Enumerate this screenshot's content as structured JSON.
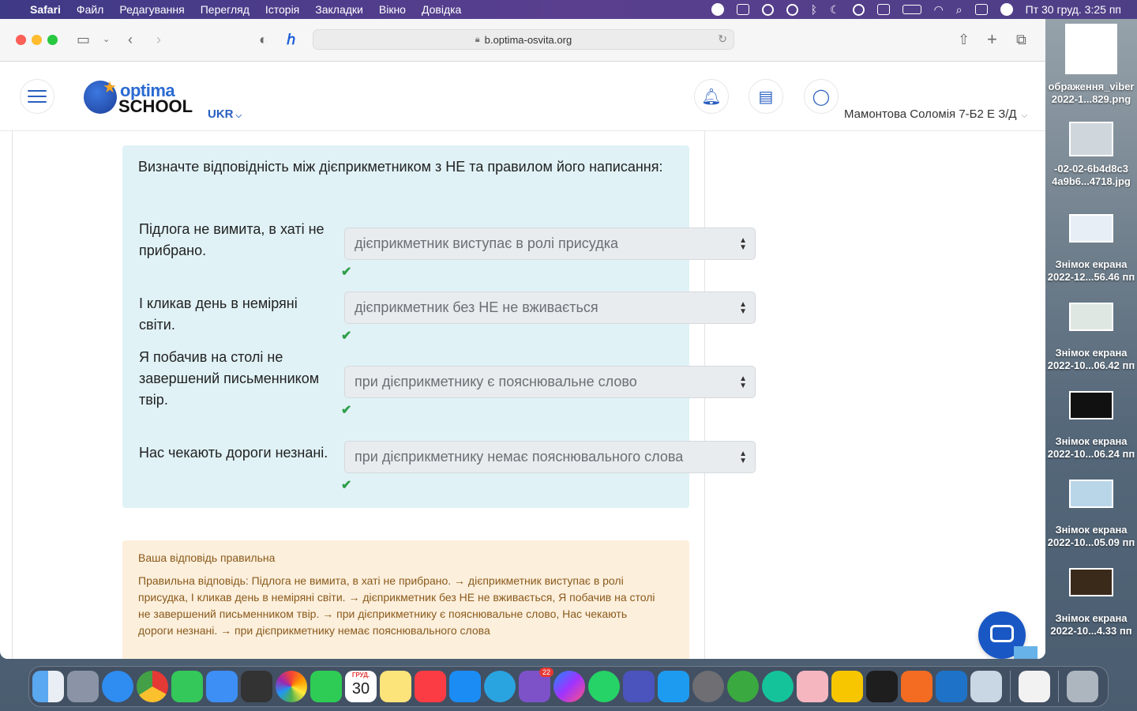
{
  "menubar": {
    "app": "Safari",
    "items": [
      "Файл",
      "Редагування",
      "Перегляд",
      "Історія",
      "Закладки",
      "Вікно",
      "Довідка"
    ],
    "clock": "Пт 30 груд.  3:25 пп"
  },
  "browser": {
    "url": "b.optima-osvita.org"
  },
  "header": {
    "logo_top": "optima",
    "logo_bottom": "SCHOOL",
    "language": "UKR",
    "user_name": "Мамонтова Соломія 7-Б2 Е З/Д"
  },
  "question": {
    "text": "Визначте відповідність між  дієприкметником з НЕ  та правилом його написання:",
    "rows": [
      {
        "label": "Підлога не вимита, в хаті не прибрано.",
        "answer": "дієприкметник виступає в ролі присудка"
      },
      {
        "label": "І кликав день в неміряні світи.",
        "answer": "дієприкметник без НЕ не вживається"
      },
      {
        "label": "Я побачив на столі не завершений письменником твір.",
        "answer": "при дієприкметнику є пояснювальне слово"
      },
      {
        "label": "Нас чекають дороги незнані.",
        "answer": "при дієприкметнику немає пояснювального слова"
      }
    ]
  },
  "feedback": {
    "title": "Ваша відповідь правильна",
    "body": "Правильна відповідь: Підлога не вимита, в хаті не прибрано. → дієприкметник виступає в ролі присудка, І кликав день в неміряні світи. → дієприкметник без НЕ не вживається, Я побачив на столі не завершений письменником твір. → при дієприкметнику є пояснювальне слово, Нас чекають дороги незнані. → при дієприкметнику немає пояснювального слова"
  },
  "desktop": {
    "items": [
      {
        "label1": "ображення_viber",
        "label2": "2022-1...829.png"
      },
      {
        "label1": "-02-02-6b4d8c3",
        "label2": "4a9b6...4718.jpg"
      },
      {
        "label1": "Знімок екрана",
        "label2": "2022-12...56.46 пп"
      },
      {
        "label1": "Знімок екрана",
        "label2": "2022-10...06.42 пп"
      },
      {
        "label1": "Знімок екрана",
        "label2": "2022-10...06.24 пп"
      },
      {
        "label1": "Знімок екрана",
        "label2": "2022-10...05.09 пп"
      },
      {
        "label1": "Знімок екрана",
        "label2": "2022-10...4.33 пп"
      }
    ]
  },
  "dock": {
    "calendar_month": "ГРУД.",
    "calendar_day": "30",
    "viber_badge": "22"
  },
  "colors": {
    "accent": "#2a5fc0",
    "question_bg": "#e0f2f6",
    "feedback_bg": "#fcefdc",
    "check": "#2e9e4a"
  }
}
